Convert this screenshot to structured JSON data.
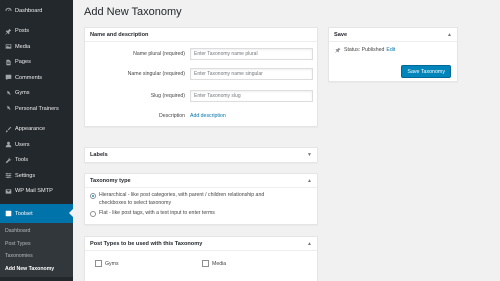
{
  "sidebar": {
    "items": [
      {
        "label": "Dashboard",
        "icon": "dashboard-icon"
      },
      {
        "label": "Posts",
        "icon": "pin-icon"
      },
      {
        "label": "Media",
        "icon": "media-icon"
      },
      {
        "label": "Pages",
        "icon": "pages-icon"
      },
      {
        "label": "Comments",
        "icon": "comments-icon"
      },
      {
        "label": "Gyms",
        "icon": "gyms-icon"
      },
      {
        "label": "Personal Trainers",
        "icon": "trainers-icon"
      },
      {
        "label": "Appearance",
        "icon": "brush-icon"
      },
      {
        "label": "Users",
        "icon": "users-icon"
      },
      {
        "label": "Tools",
        "icon": "wrench-icon"
      },
      {
        "label": "Settings",
        "icon": "settings-icon"
      },
      {
        "label": "WP Mail SMTP",
        "icon": "mail-icon"
      },
      {
        "label": "Toolset",
        "icon": "toolset-icon"
      }
    ],
    "submenu": [
      "Dashboard",
      "Post Types",
      "Taxonomies",
      "Add New Taxonomy"
    ]
  },
  "page": {
    "title": "Add New Taxonomy"
  },
  "name_box": {
    "title": "Name and description",
    "plural_label": "Name plural (required)",
    "plural_placeholder": "Enter Taxonomy name plural",
    "singular_label": "Name singular (required)",
    "singular_placeholder": "Enter Taxonomy name singular",
    "slug_label": "Slug (required)",
    "slug_placeholder": "Enter Taxonomy slug",
    "description_label": "Description",
    "description_link": "Add description"
  },
  "save_box": {
    "title": "Save",
    "status_label": "Status: Published",
    "edit_link": "Edit",
    "save_button": "Save Taxonomy"
  },
  "labels_box": {
    "title": "Labels"
  },
  "type_box": {
    "title": "Taxonomy type",
    "hierarchical_line1": "Hierarchical - like post categories, with parent / children relationship and",
    "hierarchical_line2": "checkboxes to select taxonomy",
    "flat": "Flat - like post tags, with a text input to enter terms",
    "selected": "hierarchical"
  },
  "posttypes_box": {
    "title": "Post Types to be used with this Taxonomy",
    "options": [
      "Gyms",
      "Media"
    ]
  },
  "colors": {
    "sidebar_bg": "#23282d",
    "accent": "#0073aa",
    "button": "#0085ba"
  }
}
